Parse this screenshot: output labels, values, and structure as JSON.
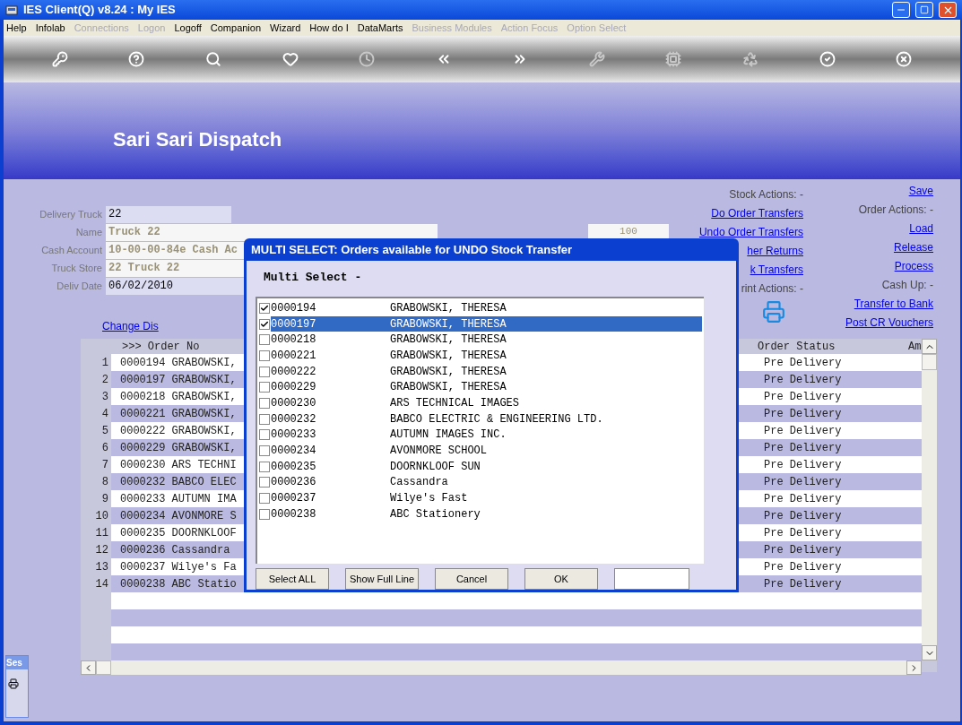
{
  "window": {
    "title": "IES Client(Q) v8.24 : My IES"
  },
  "menu": [
    {
      "label": "Help",
      "disabled": false
    },
    {
      "label": "Infolab",
      "disabled": false
    },
    {
      "label": "Connections",
      "disabled": true
    },
    {
      "label": "Logon",
      "disabled": true
    },
    {
      "label": "Logoff",
      "disabled": false
    },
    {
      "label": "Companion",
      "disabled": false
    },
    {
      "label": "Wizard",
      "disabled": false
    },
    {
      "label": "How do I",
      "disabled": false
    },
    {
      "label": "DataMarts",
      "disabled": false
    },
    {
      "label": "Business Modules",
      "disabled": true
    },
    {
      "label": "Action Focus",
      "disabled": true
    },
    {
      "label": "Option Select",
      "disabled": true
    }
  ],
  "toolbar": [
    {
      "kind": "key",
      "disabled": false
    },
    {
      "kind": "help",
      "disabled": false
    },
    {
      "kind": "search",
      "disabled": false
    },
    {
      "kind": "gap"
    },
    {
      "kind": "heart",
      "disabled": false
    },
    {
      "kind": "clock",
      "disabled": true
    },
    {
      "kind": "back",
      "disabled": false
    },
    {
      "kind": "forward",
      "disabled": false
    },
    {
      "kind": "tools",
      "disabled": true
    },
    {
      "kind": "chip",
      "disabled": true
    },
    {
      "kind": "gap"
    },
    {
      "kind": "recycle",
      "disabled": true
    },
    {
      "kind": "check",
      "disabled": false
    },
    {
      "kind": "close",
      "disabled": false
    }
  ],
  "header": {
    "title": "Sari Sari Dispatch"
  },
  "form": [
    {
      "label": "Delivery Truck",
      "value": "22",
      "readonly": false
    },
    {
      "label": "Name",
      "value": "Truck 22",
      "readonly": true
    },
    {
      "label": "Cash Account",
      "value": "10-00-00-84e Cash Ac",
      "readonly": true
    },
    {
      "label": "Truck Store",
      "value": "22 Truck 22",
      "readonly": true
    },
    {
      "label": "Deliv Date",
      "value": "06/02/2010",
      "readonly": false
    }
  ],
  "count_field": {
    "value": "100"
  },
  "change_link": "Change Dis",
  "stock_actions": [
    {
      "kind": "heading",
      "text": "Stock Actions: -"
    },
    {
      "kind": "link",
      "text": "Do Order Transfers"
    },
    {
      "kind": "link",
      "text": "Undo Order Transfers"
    },
    {
      "kind": "link",
      "text": "her Returns"
    },
    {
      "kind": "link",
      "text": "k Transfers"
    },
    {
      "kind": "heading",
      "text": "rint Actions: -"
    },
    {
      "kind": "printer"
    }
  ],
  "order_actions": [
    {
      "kind": "link",
      "text": "Save"
    },
    {
      "kind": "heading",
      "text": "Order Actions: -"
    },
    {
      "kind": "link",
      "text": "Load"
    },
    {
      "kind": "link",
      "text": "Release"
    },
    {
      "kind": "link",
      "text": "Process"
    },
    {
      "kind": "heading",
      "text": "Cash Up: -"
    },
    {
      "kind": "link",
      "text": "Transfer to Bank"
    },
    {
      "kind": "link",
      "text": "Post CR Vouchers"
    }
  ],
  "table": {
    "columns": [
      ">>> Order No",
      "Order Status",
      "Am"
    ],
    "rows": [
      {
        "number": "1",
        "order": "0000194 GRABOWSKI,",
        "status": "Pre Delivery"
      },
      {
        "number": "2",
        "order": "0000197 GRABOWSKI,",
        "status": "Pre Delivery"
      },
      {
        "number": "3",
        "order": "0000218 GRABOWSKI,",
        "status": "Pre Delivery"
      },
      {
        "number": "4",
        "order": "0000221 GRABOWSKI,",
        "status": "Pre Delivery"
      },
      {
        "number": "5",
        "order": "0000222 GRABOWSKI,",
        "status": "Pre Delivery"
      },
      {
        "number": "6",
        "order": "0000229 GRABOWSKI,",
        "status": "Pre Delivery"
      },
      {
        "number": "7",
        "order": "0000230 ARS TECHNI",
        "status": "Pre Delivery"
      },
      {
        "number": "8",
        "order": "0000232 BABCO ELEC",
        "status": "Pre Delivery"
      },
      {
        "number": "9",
        "order": "0000233 AUTUMN IMA",
        "status": "Pre Delivery"
      },
      {
        "number": "10",
        "order": "0000234 AVONMORE S",
        "status": "Pre Delivery"
      },
      {
        "number": "11",
        "order": "0000235 DOORNKLOOF",
        "status": "Pre Delivery"
      },
      {
        "number": "12",
        "order": "0000236 Cassandra",
        "status": "Pre Delivery"
      },
      {
        "number": "13",
        "order": "0000237 Wilye's Fa",
        "status": "Pre Delivery"
      },
      {
        "number": "14",
        "order": "0000238 ABC Statio",
        "status": "Pre Delivery"
      }
    ]
  },
  "session_panel": {
    "title": "Ses"
  },
  "dialog": {
    "title": "MULTI SELECT: Orders available for UNDO Stock Transfer",
    "heading": "Multi Select -",
    "items": [
      {
        "id": "0000194",
        "name": "GRABOWSKI, THERESA",
        "checked": true,
        "selected": false
      },
      {
        "id": "0000197",
        "name": "GRABOWSKI, THERESA",
        "checked": true,
        "selected": true
      },
      {
        "id": "0000218",
        "name": "GRABOWSKI, THERESA",
        "checked": false,
        "selected": false
      },
      {
        "id": "0000221",
        "name": "GRABOWSKI, THERESA",
        "checked": false,
        "selected": false
      },
      {
        "id": "0000222",
        "name": "GRABOWSKI, THERESA",
        "checked": false,
        "selected": false
      },
      {
        "id": "0000229",
        "name": "GRABOWSKI, THERESA",
        "checked": false,
        "selected": false
      },
      {
        "id": "0000230",
        "name": "ARS TECHNICAL IMAGES",
        "checked": false,
        "selected": false
      },
      {
        "id": "0000232",
        "name": "BABCO ELECTRIC & ENGINEERING LTD.",
        "checked": false,
        "selected": false
      },
      {
        "id": "0000233",
        "name": "AUTUMN IMAGES INC.",
        "checked": false,
        "selected": false
      },
      {
        "id": "0000234",
        "name": "AVONMORE SCHOOL",
        "checked": false,
        "selected": false
      },
      {
        "id": "0000235",
        "name": "DOORNKLOOF SUN",
        "checked": false,
        "selected": false
      },
      {
        "id": "0000236",
        "name": "Cassandra",
        "checked": false,
        "selected": false
      },
      {
        "id": "0000237",
        "name": "Wilye's Fast",
        "checked": false,
        "selected": false
      },
      {
        "id": "0000238",
        "name": "ABC Stationery",
        "checked": false,
        "selected": false
      }
    ],
    "buttons": [
      "Select ALL",
      "Show Full Line",
      "Cancel",
      "OK"
    ]
  }
}
